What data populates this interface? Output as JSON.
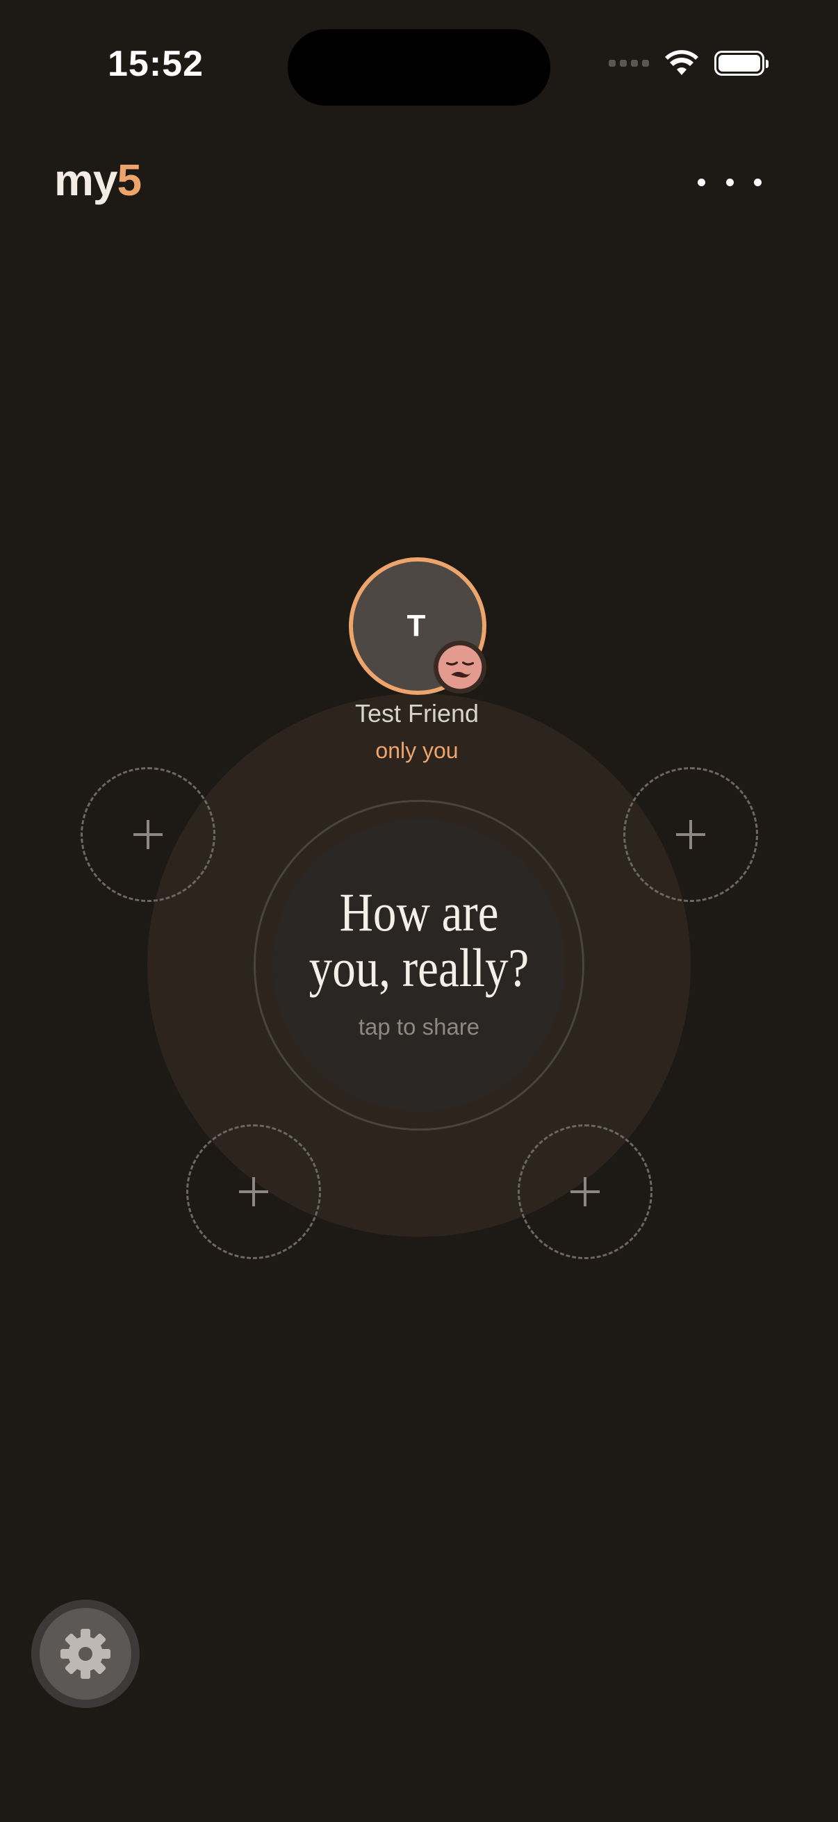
{
  "status_bar": {
    "time": "15:52"
  },
  "header": {
    "logo_word": "my",
    "logo_number": "5"
  },
  "icons": {
    "more": "more-horizontal-icon",
    "wifi": "wifi-icon",
    "battery": "battery-icon",
    "cellular": "cellular-signal-icon",
    "add": "plus-icon",
    "settings": "gear-icon",
    "mood": "sleepy-face-icon"
  },
  "friend": {
    "initial": "T",
    "name": "Test Friend",
    "status": "only you"
  },
  "center": {
    "title": "How are you, really?",
    "subtitle": "tap to share"
  },
  "colors": {
    "background": "#1d1a16",
    "accent": "#eda56c",
    "glow": "#2c241d",
    "center": "#292624"
  }
}
